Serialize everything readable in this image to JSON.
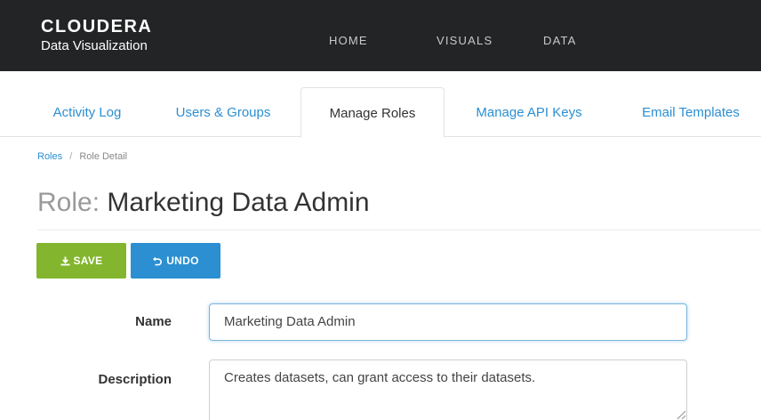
{
  "header": {
    "brand_name": "CLOUDERA",
    "brand_sub": "Data Visualization",
    "nav": [
      {
        "label": "HOME"
      },
      {
        "label": "VISUALS"
      },
      {
        "label": "DATA"
      }
    ]
  },
  "tabs": [
    {
      "label": "Activity Log"
    },
    {
      "label": "Users & Groups"
    },
    {
      "label": "Manage Roles"
    },
    {
      "label": "Manage API Keys"
    },
    {
      "label": "Email Templates"
    }
  ],
  "breadcrumb": {
    "root": "Roles",
    "separator": "/",
    "current": "Role Detail"
  },
  "page": {
    "title_prefix": "Role:",
    "title_name": "Marketing Data Admin"
  },
  "toolbar": {
    "save_label": "SAVE",
    "undo_label": "UNDO"
  },
  "form": {
    "name_label": "Name",
    "name_value": "Marketing Data Admin",
    "description_label": "Description",
    "description_value": "Creates datasets, can grant access to their datasets."
  },
  "colors": {
    "topbar": "#222426",
    "link": "#2b8fd1",
    "save": "#83b62e",
    "undo": "#2b8fd1"
  },
  "icons": {
    "save": "download-icon",
    "undo": "undo-icon"
  }
}
